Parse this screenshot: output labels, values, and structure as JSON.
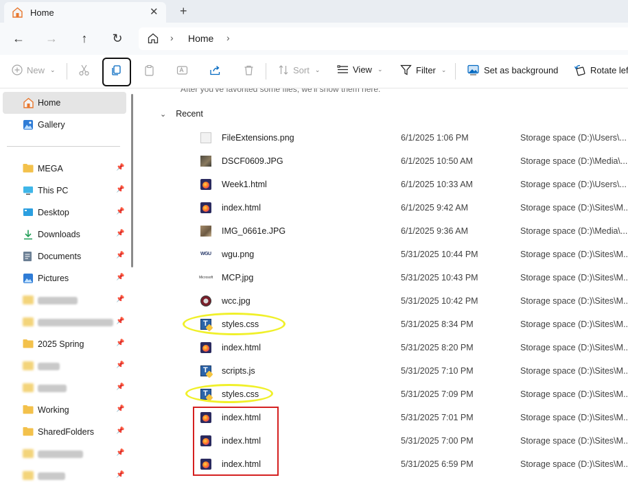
{
  "window": {
    "tab_title": "Home",
    "tab_close": "✕",
    "new_tab": "+"
  },
  "nav": {
    "back": "←",
    "forward": "→",
    "up": "↑",
    "refresh": "↻",
    "breadcrumb": "Home",
    "sep": "›"
  },
  "toolbar": {
    "new_label": "New",
    "sort_label": "Sort",
    "view_label": "View",
    "filter_label": "Filter",
    "set_background_label": "Set as background",
    "rotate_left_label": "Rotate left"
  },
  "sidebar": {
    "items": [
      {
        "label": "Home",
        "icon": "home-icon",
        "selected": true
      },
      {
        "label": "Gallery",
        "icon": "gallery-icon"
      }
    ],
    "pinned": [
      {
        "label": "MEGA",
        "icon": "folder-icon"
      },
      {
        "label": "This PC",
        "icon": "pc-icon"
      },
      {
        "label": "Desktop",
        "icon": "desktop-icon"
      },
      {
        "label": "Downloads",
        "icon": "download-icon"
      },
      {
        "label": "Documents",
        "icon": "documents-icon"
      },
      {
        "label": "Pictures",
        "icon": "pictures-icon"
      },
      {
        "label": "2025 Spring",
        "icon": "folder-icon"
      },
      {
        "label": "Working",
        "icon": "folder-icon"
      },
      {
        "label": "SharedFolders",
        "icon": "folder-icon"
      }
    ],
    "pin_glyph": "📌"
  },
  "main": {
    "favorites_hint": "After you've favorited some files, we'll show them here.",
    "recent_heading": "Recent",
    "files": [
      {
        "name": "FileExtensions.png",
        "date": "6/1/2025 1:06 PM",
        "location": "Storage space (D:)\\Users\\...",
        "icon": "png"
      },
      {
        "name": "DSCF0609.JPG",
        "date": "6/1/2025 10:50 AM",
        "location": "Storage space (D:)\\Media\\...",
        "icon": "photo"
      },
      {
        "name": "Week1.html",
        "date": "6/1/2025 10:33 AM",
        "location": "Storage space (D:)\\Users\\...",
        "icon": "html"
      },
      {
        "name": "index.html",
        "date": "6/1/2025 9:42 AM",
        "location": "Storage space (D:)\\Sites\\M...",
        "icon": "html"
      },
      {
        "name": "IMG_0661e.JPG",
        "date": "6/1/2025 9:36 AM",
        "location": "Storage space (D:)\\Media\\...",
        "icon": "photo2"
      },
      {
        "name": "wgu.png",
        "date": "5/31/2025 10:44 PM",
        "location": "Storage space (D:)\\Sites\\M...",
        "icon": "wgu"
      },
      {
        "name": "MCP.jpg",
        "date": "5/31/2025 10:43 PM",
        "location": "Storage space (D:)\\Sites\\M...",
        "icon": "mcp"
      },
      {
        "name": "wcc.jpg",
        "date": "5/31/2025 10:42 PM",
        "location": "Storage space (D:)\\Sites\\M...",
        "icon": "wcc"
      },
      {
        "name": "styles.css",
        "date": "5/31/2025 8:34 PM",
        "location": "Storage space (D:)\\Sites\\M...",
        "icon": "css"
      },
      {
        "name": "index.html",
        "date": "5/31/2025 8:20 PM",
        "location": "Storage space (D:)\\Sites\\M...",
        "icon": "html"
      },
      {
        "name": "scripts.js",
        "date": "5/31/2025 7:10 PM",
        "location": "Storage space (D:)\\Sites\\M...",
        "icon": "css"
      },
      {
        "name": "styles.css",
        "date": "5/31/2025 7:09 PM",
        "location": "Storage space (D:)\\Sites\\M...",
        "icon": "css"
      },
      {
        "name": "index.html",
        "date": "5/31/2025 7:01 PM",
        "location": "Storage space (D:)\\Sites\\M...",
        "icon": "html"
      },
      {
        "name": "index.html",
        "date": "5/31/2025 7:00 PM",
        "location": "Storage space (D:)\\Sites\\M...",
        "icon": "html"
      },
      {
        "name": "index.html",
        "date": "5/31/2025 6:59 PM",
        "location": "Storage space (D:)\\Sites\\M...",
        "icon": "html"
      }
    ]
  },
  "colors": {
    "accent": "#0067c0",
    "folder": "#f3c14b",
    "highlight_ellipse": "#f0f02a",
    "highlight_rect": "#d41f1f"
  }
}
